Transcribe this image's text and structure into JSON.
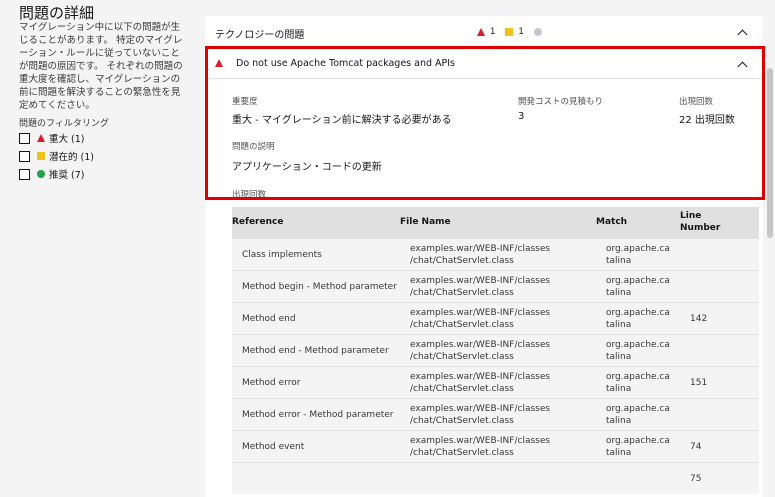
{
  "left": {
    "title": "問題の詳細",
    "description": "マイグレーション中に以下の問題が生じることがあります。 特定のマイグレーション・ルールに従っていないことが問題の原因です。 それぞれの問題の重大度を確認し、マイグレーションの前に問題を解決することの緊急性を見定めてください。",
    "filter_label": "問題のフィルタリング",
    "filters": [
      {
        "label": "重大 (1)",
        "icon": "triangle-red-icon"
      },
      {
        "label": "潜在的 (1)",
        "icon": "square-yellow-icon"
      },
      {
        "label": "推奨 (7)",
        "icon": "circle-green-icon"
      }
    ]
  },
  "tech": {
    "title": "テクノロジーの問題",
    "critical_count": "1",
    "potential_count": "1"
  },
  "issue": {
    "title": "Do not use Apache Tomcat packages and APIs",
    "severity_label": "重要度",
    "severity_value": "重大 - マイグレーション前に解決する必要がある",
    "cost_label": "開発コストの見積もり",
    "cost_value": "3",
    "occ_label": "出現回数",
    "occ_value": "22 出現回数",
    "desc_label": "問題の説明",
    "desc_value": "アプリケーション・コードの更新",
    "occ_section_label": "出現回数"
  },
  "table": {
    "headers": [
      "Reference",
      "File Name",
      "Match",
      "Line",
      "Number"
    ],
    "rows": [
      {
        "ref": "Class implements",
        "file1": "examples.war/WEB-INF/classes",
        "file2": "/chat/ChatServlet.class",
        "m1": "org.apache.ca",
        "m2": "talina",
        "line": ""
      },
      {
        "ref": "Method begin - Method parameter",
        "file1": "examples.war/WEB-INF/classes",
        "file2": "/chat/ChatServlet.class",
        "m1": "org.apache.ca",
        "m2": "talina",
        "line": ""
      },
      {
        "ref": "Method end",
        "file1": "examples.war/WEB-INF/classes",
        "file2": "/chat/ChatServlet.class",
        "m1": "org.apache.ca",
        "m2": "talina",
        "line": "142"
      },
      {
        "ref": "Method end - Method parameter",
        "file1": "examples.war/WEB-INF/classes",
        "file2": "/chat/ChatServlet.class",
        "m1": "org.apache.ca",
        "m2": "talina",
        "line": ""
      },
      {
        "ref": "Method error",
        "file1": "examples.war/WEB-INF/classes",
        "file2": "/chat/ChatServlet.class",
        "m1": "org.apache.ca",
        "m2": "talina",
        "line": "151"
      },
      {
        "ref": "Method error - Method parameter",
        "file1": "examples.war/WEB-INF/classes",
        "file2": "/chat/ChatServlet.class",
        "m1": "org.apache.ca",
        "m2": "talina",
        "line": ""
      },
      {
        "ref": "Method event",
        "file1": "examples.war/WEB-INF/classes",
        "file2": "/chat/ChatServlet.class",
        "m1": "org.apache.ca",
        "m2": "talina",
        "line": "74"
      },
      {
        "ref": "",
        "file1": "",
        "file2": "",
        "m1": "",
        "m2": "",
        "line": "75"
      }
    ]
  },
  "colors": {
    "critical": "#da1e28",
    "potential": "#f1c21b",
    "optional": "#24a148",
    "highlight": "#e00000"
  }
}
